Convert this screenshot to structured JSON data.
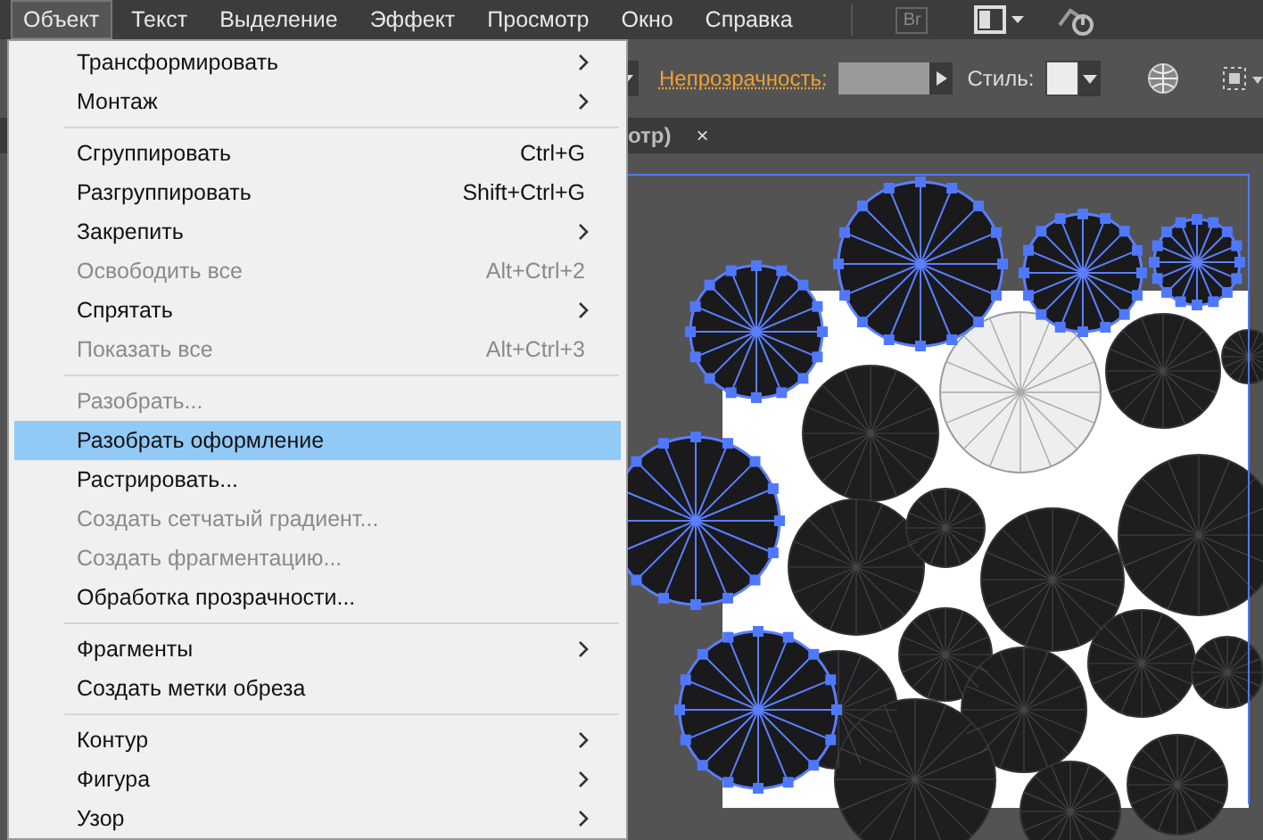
{
  "menubar": {
    "items": [
      {
        "label": "Объект",
        "selected": true
      },
      {
        "label": "Текст",
        "selected": false
      },
      {
        "label": "Выделение",
        "selected": false
      },
      {
        "label": "Эффект",
        "selected": false
      },
      {
        "label": "Просмотр",
        "selected": false
      },
      {
        "label": "Окно",
        "selected": false
      },
      {
        "label": "Справка",
        "selected": false
      }
    ],
    "bridge_label": "Br"
  },
  "control_bar": {
    "opacity_label": "Непрозрачность:",
    "style_label": "Стиль:"
  },
  "document_tabs": [
    {
      "label": "отр)",
      "close": "×"
    }
  ],
  "menu": {
    "items": [
      {
        "kind": "item",
        "label": "Трансформировать",
        "submenu": true,
        "disabled": false,
        "selected": false
      },
      {
        "kind": "item",
        "label": "Монтаж",
        "submenu": true,
        "disabled": false,
        "selected": false
      },
      {
        "kind": "separator"
      },
      {
        "kind": "item",
        "label": "Сгруппировать",
        "shortcut": "Ctrl+G",
        "submenu": false,
        "disabled": false,
        "selected": false
      },
      {
        "kind": "item",
        "label": "Разгруппировать",
        "shortcut": "Shift+Ctrl+G",
        "submenu": false,
        "disabled": false,
        "selected": false
      },
      {
        "kind": "item",
        "label": "Закрепить",
        "submenu": true,
        "disabled": false,
        "selected": false
      },
      {
        "kind": "item",
        "label": "Освободить все",
        "shortcut": "Alt+Ctrl+2",
        "submenu": false,
        "disabled": true,
        "selected": false
      },
      {
        "kind": "item",
        "label": "Спрятать",
        "submenu": true,
        "disabled": false,
        "selected": false
      },
      {
        "kind": "item",
        "label": "Показать все",
        "shortcut": "Alt+Ctrl+3",
        "submenu": false,
        "disabled": true,
        "selected": false
      },
      {
        "kind": "separator"
      },
      {
        "kind": "item",
        "label": "Разобрать...",
        "submenu": false,
        "disabled": true,
        "selected": false
      },
      {
        "kind": "item",
        "label": "Разобрать оформление",
        "submenu": false,
        "disabled": false,
        "selected": true
      },
      {
        "kind": "item",
        "label": "Растрировать...",
        "submenu": false,
        "disabled": false,
        "selected": false
      },
      {
        "kind": "item",
        "label": "Создать сетчатый градиент...",
        "submenu": false,
        "disabled": true,
        "selected": false
      },
      {
        "kind": "item",
        "label": "Создать фрагментацию...",
        "submenu": false,
        "disabled": true,
        "selected": false
      },
      {
        "kind": "item",
        "label": "Обработка прозрачности...",
        "submenu": false,
        "disabled": false,
        "selected": false
      },
      {
        "kind": "separator"
      },
      {
        "kind": "item",
        "label": "Фрагменты",
        "submenu": true,
        "disabled": false,
        "selected": false
      },
      {
        "kind": "item",
        "label": "Создать метки обреза",
        "submenu": false,
        "disabled": false,
        "selected": false
      },
      {
        "kind": "separator"
      },
      {
        "kind": "item",
        "label": "Контур",
        "submenu": true,
        "disabled": false,
        "selected": false
      },
      {
        "kind": "item",
        "label": "Фигура",
        "submenu": true,
        "disabled": false,
        "selected": false
      },
      {
        "kind": "item",
        "label": "Узор",
        "submenu": true,
        "disabled": false,
        "selected": false
      }
    ]
  }
}
